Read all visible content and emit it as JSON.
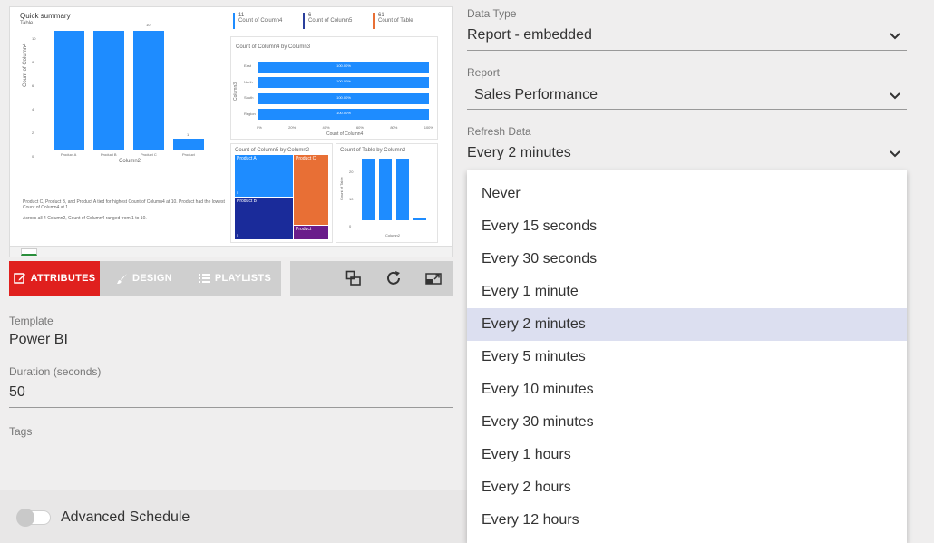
{
  "preview": {
    "title": "Quick summary",
    "subtitle": "Table",
    "kpis": [
      {
        "value": "11",
        "label": "Count of Column4",
        "color": "#1e8cff"
      },
      {
        "value": "6",
        "label": "Count of Column5",
        "color": "#2a3f9c"
      },
      {
        "value": "61",
        "label": "Count of Table",
        "color": "#e86f35"
      }
    ],
    "chart_left": {
      "ylabel": "Count of Column4",
      "xlabel": "Column2",
      "categories": [
        "Product A",
        "Product B",
        "Product C",
        "Product"
      ],
      "values": [
        10,
        10,
        10,
        1
      ],
      "top_label": "10",
      "small_label": "1",
      "yticks": [
        "10",
        "8",
        "6",
        "4",
        "2",
        "0"
      ]
    },
    "narrative": {
      "line1": "Product C, Product B, and Product A tied for highest Count of Column4 at 10. Product had the lowest Count of Column4 at 1.",
      "line2": "Across all 4 Column2, Count of Column4 ranged from 1 to 10."
    },
    "chart_h": {
      "title": "Count of Column4 by Column3",
      "ylabel": "Column3",
      "xlabel": "Count of Column4",
      "categories": [
        "East",
        "North",
        "South",
        "Region"
      ],
      "bar_label": "100.00%",
      "xticks": [
        "0%",
        "20%",
        "40%",
        "60%",
        "80%",
        "100%"
      ]
    },
    "treemap": {
      "title": "Count of Column5 by Column2",
      "tiles": [
        {
          "label": "Product A",
          "n": "5",
          "color": "#1e8cff"
        },
        {
          "label": "Product C",
          "n": "",
          "color": "#e86f35"
        },
        {
          "label": "Product B",
          "n": "5",
          "color": "#1a2b9a"
        },
        {
          "label": "Product",
          "n": "",
          "color": "#6a1c8a"
        }
      ]
    },
    "chart_small": {
      "title": "Count of Table by Column2",
      "ylabel": "Count of Table",
      "xlabel": "Column2",
      "categories": [
        "Product A",
        "Product B",
        "Product C",
        "Product"
      ],
      "values": [
        20,
        20,
        20,
        1
      ],
      "yticks": [
        "20",
        "10",
        "0"
      ]
    }
  },
  "tabs": {
    "attributes": "ATTRIBUTES",
    "design": "DESIGN",
    "playlists": "PLAYLISTS"
  },
  "fields": {
    "template_label": "Template",
    "template_value": "Power BI",
    "duration_label": "Duration (seconds)",
    "duration_value": "50",
    "tags_label": "Tags"
  },
  "advanced": {
    "label": "Advanced Schedule",
    "enabled": false
  },
  "right": {
    "data_type_label": "Data Type",
    "data_type_value": "Report - embedded",
    "report_label": "Report",
    "report_value": "Sales Performance",
    "refresh_label": "Refresh Data",
    "refresh_value": "Every 2 minutes"
  },
  "refresh_options": [
    "Never",
    "Every 15 seconds",
    "Every 30 seconds",
    "Every 1 minute",
    "Every 2 minutes",
    "Every 5 minutes",
    "Every 10 minutes",
    "Every 30 minutes",
    "Every 1 hours",
    "Every 2 hours",
    "Every 12 hours"
  ],
  "selected_option": "Every 2 minutes",
  "colors": {
    "accent": "#e0201e",
    "selected_bg": "#dcdff0",
    "bar_blue": "#1e8cff"
  }
}
